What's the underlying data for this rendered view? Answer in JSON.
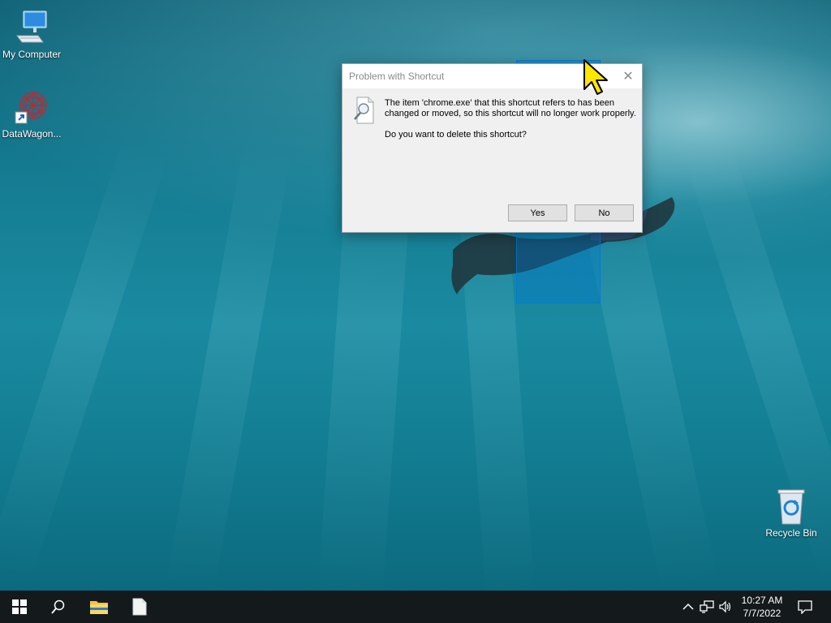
{
  "desktop": {
    "icons": [
      {
        "label": "My Computer",
        "icon": "monitor-icon"
      },
      {
        "label": "DataWagon...",
        "icon": "datawagon-shortcut-icon"
      },
      {
        "label": "Recycle Bin",
        "icon": "recycle-bin-icon"
      }
    ]
  },
  "dialog": {
    "title": "Problem with Shortcut",
    "message": "The item 'chrome.exe' that this shortcut refers to has been changed or moved, so this shortcut will no longer work properly.",
    "question": "Do you want to delete this shortcut?",
    "yes_label": "Yes",
    "no_label": "No",
    "icon": "search-document-icon"
  },
  "taskbar": {
    "buttons": [
      "windows-start-icon",
      "search-icon",
      "file-explorer-icon",
      "blank-file-icon"
    ],
    "tray": [
      "chevron-up-icon",
      "network-icon",
      "volume-icon",
      "notification-icon"
    ],
    "time": "10:27 AM",
    "date": "7/7/2022"
  },
  "colors": {
    "taskbar_bg": "#14191c",
    "dialog_bg": "#f0f0f0",
    "selection": "#0078d7",
    "cursor": "#ffe600"
  }
}
